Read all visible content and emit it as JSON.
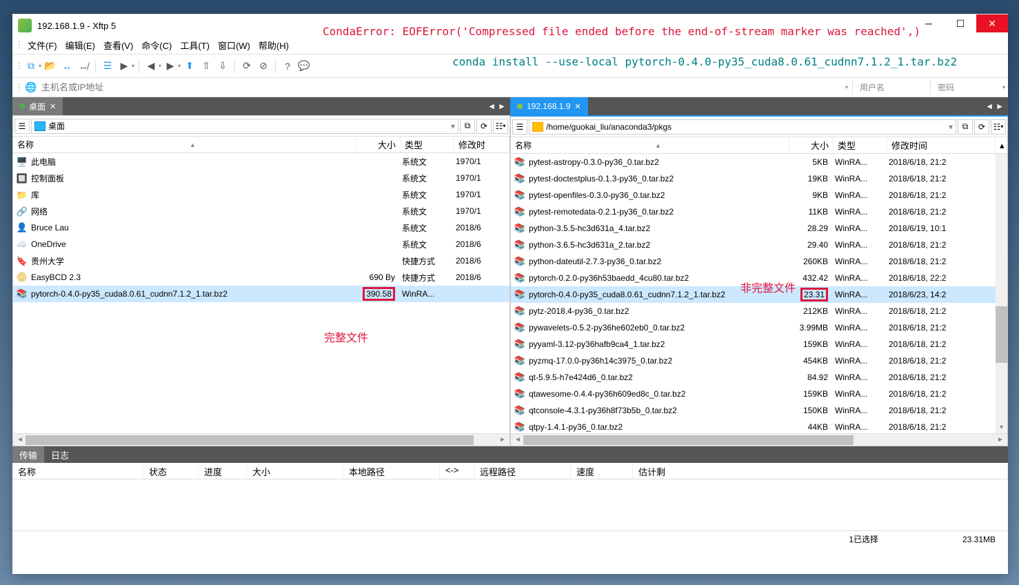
{
  "title": "192.168.1.9   - Xftp 5",
  "menus": [
    "文件(F)",
    "编辑(E)",
    "查看(V)",
    "命令(C)",
    "工具(T)",
    "窗口(W)",
    "帮助(H)"
  ],
  "address_placeholder": "主机名或IP地址",
  "user_label": "用户名",
  "pass_label": "密码",
  "left_tab": "桌面",
  "right_tab": "192.168.1.9",
  "left_path": "桌面",
  "right_path": "/home/guokai_liu/anaconda3/pkgs",
  "columns": {
    "name": "名称",
    "size": "大小",
    "type": "类型",
    "date": "修改时间",
    "date_short": "修改时"
  },
  "left_files": [
    {
      "icon": "pc",
      "name": "此电脑",
      "size": "",
      "type": "系统文",
      "date": "1970/1"
    },
    {
      "icon": "cp",
      "name": "控制面板",
      "size": "",
      "type": "系统文",
      "date": "1970/1"
    },
    {
      "icon": "lib",
      "name": "库",
      "size": "",
      "type": "系统文",
      "date": "1970/1"
    },
    {
      "icon": "net",
      "name": "网络",
      "size": "",
      "type": "系统文",
      "date": "1970/1"
    },
    {
      "icon": "user",
      "name": "Bruce Lau",
      "size": "",
      "type": "系统文",
      "date": "2018/6"
    },
    {
      "icon": "od",
      "name": "OneDrive",
      "size": "",
      "type": "系统文",
      "date": "2018/6"
    },
    {
      "icon": "link",
      "name": "贵州大学",
      "size": "",
      "type": "快捷方式",
      "date": "2018/6"
    },
    {
      "icon": "bcd",
      "name": "EasyBCD 2.3",
      "size": "690 By",
      "type": "快捷方式",
      "date": "2018/6"
    },
    {
      "icon": "rar",
      "name": "pytorch-0.4.0-py35_cuda8.0.61_cudnn7.1.2_1.tar.bz2",
      "size": "390.58",
      "type": "WinRA...",
      "date": "",
      "sel": true,
      "redbox": true
    }
  ],
  "right_files": [
    {
      "name": "pytest-astropy-0.3.0-py36_0.tar.bz2",
      "size": "5KB",
      "type": "WinRA...",
      "date": "2018/6/18, 21:2"
    },
    {
      "name": "pytest-doctestplus-0.1.3-py36_0.tar.bz2",
      "size": "19KB",
      "type": "WinRA...",
      "date": "2018/6/18, 21:2"
    },
    {
      "name": "pytest-openfiles-0.3.0-py36_0.tar.bz2",
      "size": "9KB",
      "type": "WinRA...",
      "date": "2018/6/18, 21:2"
    },
    {
      "name": "pytest-remotedata-0.2.1-py36_0.tar.bz2",
      "size": "11KB",
      "type": "WinRA...",
      "date": "2018/6/18, 21:2"
    },
    {
      "name": "python-3.5.5-hc3d631a_4.tar.bz2",
      "size": "28.29",
      "type": "WinRA...",
      "date": "2018/6/19, 10:1"
    },
    {
      "name": "python-3.6.5-hc3d631a_2.tar.bz2",
      "size": "29.40",
      "type": "WinRA...",
      "date": "2018/6/18, 21:2"
    },
    {
      "name": "python-dateutil-2.7.3-py36_0.tar.bz2",
      "size": "260KB",
      "type": "WinRA...",
      "date": "2018/6/18, 21:2"
    },
    {
      "name": "pytorch-0.2.0-py36h53baedd_4cu80.tar.bz2",
      "size": "432.42",
      "type": "WinRA...",
      "date": "2018/6/18, 22:2"
    },
    {
      "name": "pytorch-0.4.0-py35_cuda8.0.61_cudnn7.1.2_1.tar.bz2",
      "size": "23.31",
      "type": "WinRA...",
      "date": "2018/6/23, 14:2",
      "sel": true,
      "redbox": true
    },
    {
      "name": "pytz-2018.4-py36_0.tar.bz2",
      "size": "212KB",
      "type": "WinRA...",
      "date": "2018/6/18, 21:2"
    },
    {
      "name": "pywavelets-0.5.2-py36he602eb0_0.tar.bz2",
      "size": "3.99MB",
      "type": "WinRA...",
      "date": "2018/6/18, 21:2"
    },
    {
      "name": "pyyaml-3.12-py36hafb9ca4_1.tar.bz2",
      "size": "159KB",
      "type": "WinRA...",
      "date": "2018/6/18, 21:2"
    },
    {
      "name": "pyzmq-17.0.0-py36h14c3975_0.tar.bz2",
      "size": "454KB",
      "type": "WinRA...",
      "date": "2018/6/18, 21:2"
    },
    {
      "name": "qt-5.9.5-h7e424d6_0.tar.bz2",
      "size": "84.92",
      "type": "WinRA...",
      "date": "2018/6/18, 21:2"
    },
    {
      "name": "qtawesome-0.4.4-py36h609ed8c_0.tar.bz2",
      "size": "159KB",
      "type": "WinRA...",
      "date": "2018/6/18, 21:2"
    },
    {
      "name": "qtconsole-4.3.1-py36h8f73b5b_0.tar.bz2",
      "size": "150KB",
      "type": "WinRA...",
      "date": "2018/6/18, 21:2"
    },
    {
      "name": "qtpy-1.4.1-py36_0.tar.bz2",
      "size": "44KB",
      "type": "WinRA...",
      "date": "2018/6/18, 21:2"
    }
  ],
  "transfer_tabs": [
    "传输",
    "日志"
  ],
  "transfer_cols": [
    "名称",
    "状态",
    "进度",
    "大小",
    "本地路径",
    "<->",
    "远程路径",
    "速度",
    "估计剩"
  ],
  "status": {
    "selected": "1已选择",
    "size": "23.31MB"
  },
  "overlays": {
    "error": "CondaError: EOFError('Compressed file ended before the end-of-stream marker was reached',)",
    "command": "conda install --use-local pytorch-0.4.0-py35_cuda8.0.61_cudnn7.1.2_1.tar.bz2",
    "label_left": "完整文件",
    "label_right": "非完整文件"
  },
  "icons": {
    "pc": "🖥️",
    "cp": "🔲",
    "lib": "📁",
    "net": "🔗",
    "user": "👤",
    "od": "☁️",
    "link": "🔖",
    "bcd": "📀",
    "rar": "📚"
  }
}
